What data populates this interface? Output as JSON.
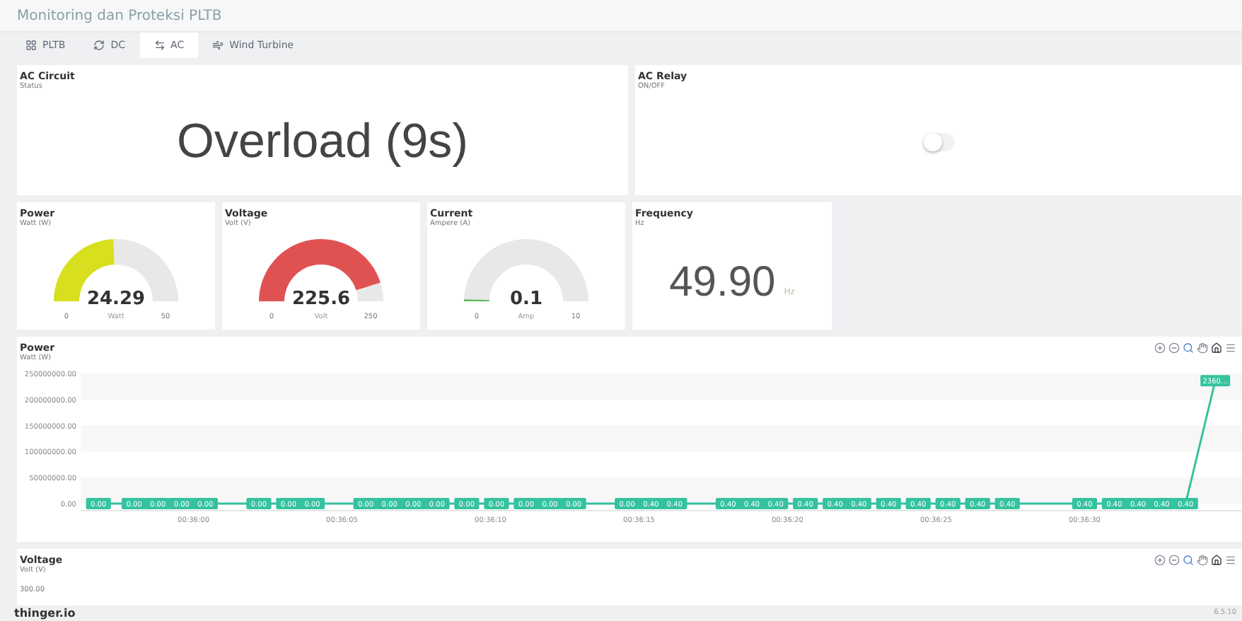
{
  "header": {
    "title": "Monitoring dan Proteksi PLTB"
  },
  "tabs": [
    {
      "label": "PLTB",
      "selected": false
    },
    {
      "label": "DC",
      "selected": false
    },
    {
      "label": "AC",
      "selected": true
    },
    {
      "label": "Wind Turbine",
      "selected": false
    }
  ],
  "status_card": {
    "title": "AC Circuit",
    "subtitle": "Status",
    "value": "Overload (9s)"
  },
  "relay_card": {
    "title": "AC Relay",
    "subtitle": "ON/OFF",
    "on": false
  },
  "gauges": [
    {
      "title": "Power",
      "subtitle": "Watt (W)",
      "value": "24.29",
      "unit": "Watt",
      "min": "0",
      "max": "50",
      "color": "#d7df1f"
    },
    {
      "title": "Voltage",
      "subtitle": "Volt (V)",
      "value": "225.6",
      "unit": "Volt",
      "min": "0",
      "max": "250",
      "color": "#e05252"
    },
    {
      "title": "Current",
      "subtitle": "Ampere (A)",
      "value": "0.1",
      "unit": "Amp",
      "min": "0",
      "max": "10",
      "color": "#5cb85c"
    }
  ],
  "frequency_card": {
    "title": "Frequency",
    "subtitle": "Hz",
    "value": "49.90",
    "unit": "Hz"
  },
  "power_chart": {
    "title": "Power",
    "subtitle": "Watt (W)",
    "chart_data": {
      "type": "line",
      "xlim": [
        2156.2,
        2195.3
      ],
      "ylim": [
        0,
        250000000
      ],
      "yticks": [
        {
          "value": 0,
          "label": "0.00"
        },
        {
          "value": 50000000,
          "label": "50000000.00"
        },
        {
          "value": 100000000,
          "label": "100000000.00"
        },
        {
          "value": 150000000,
          "label": "150000000.00"
        },
        {
          "value": 200000000,
          "label": "200000000.00"
        },
        {
          "value": 250000000,
          "label": "250000000.00"
        }
      ],
      "xticks": [
        {
          "value": 2160,
          "label": "00:36:00"
        },
        {
          "value": 2165,
          "label": "00:36:05"
        },
        {
          "value": 2170,
          "label": "00:36:10"
        },
        {
          "value": 2175,
          "label": "00:36:15"
        },
        {
          "value": 2180,
          "label": "00:36:20"
        },
        {
          "value": 2185,
          "label": "00:36:25"
        },
        {
          "value": 2190,
          "label": "00:36:30"
        }
      ],
      "x": [
        2156.8,
        2158,
        2158.8,
        2159.6,
        2160.4,
        2162.2,
        2163.2,
        2164,
        2165.8,
        2166.6,
        2167.4,
        2168.2,
        2169.2,
        2170.2,
        2171.2,
        2172,
        2172.8,
        2174.6,
        2175.4,
        2176.2,
        2178,
        2178.8,
        2179.6,
        2180.6,
        2181.6,
        2182.4,
        2183.4,
        2184.4,
        2185.4,
        2186.4,
        2187.4,
        2190,
        2191,
        2191.8,
        2192.6,
        2193.4,
        2194.4
      ],
      "series": [
        {
          "color": "#35c29f",
          "marker": true,
          "values": [
            0,
            0,
            0,
            0,
            0,
            0,
            0,
            0,
            0,
            0,
            0,
            0,
            0,
            0,
            0,
            0,
            0,
            0,
            0,
            0,
            0,
            0,
            0,
            0,
            0,
            0,
            0,
            0,
            0,
            0,
            0,
            0,
            0,
            0,
            0,
            0,
            236000000
          ]
        }
      ],
      "value_labels": [
        "0.00",
        "0.00",
        "0.00",
        "0.00",
        "0.00",
        "0.00",
        "0.00",
        "0.00",
        "0.00",
        "0.00",
        "0.00",
        "0.00",
        "0.00",
        "0.00",
        "0.00",
        "0.00",
        "0.00",
        "0.00",
        "0.40",
        "0.40",
        "0.40",
        "0.40",
        "0.40",
        "0.40",
        "0.40",
        "0.40",
        "0.40",
        "0.40",
        "0.40",
        "0.40",
        "0.40",
        "0.40",
        "0.40",
        "0.40",
        "0.40",
        "0.40",
        "2360…"
      ]
    }
  },
  "voltage_chart": {
    "title": "Voltage",
    "subtitle": "Volt (V)",
    "top_tick": "300.00"
  },
  "footer": {
    "brand": "thinger.io",
    "version": "6.5.10"
  }
}
